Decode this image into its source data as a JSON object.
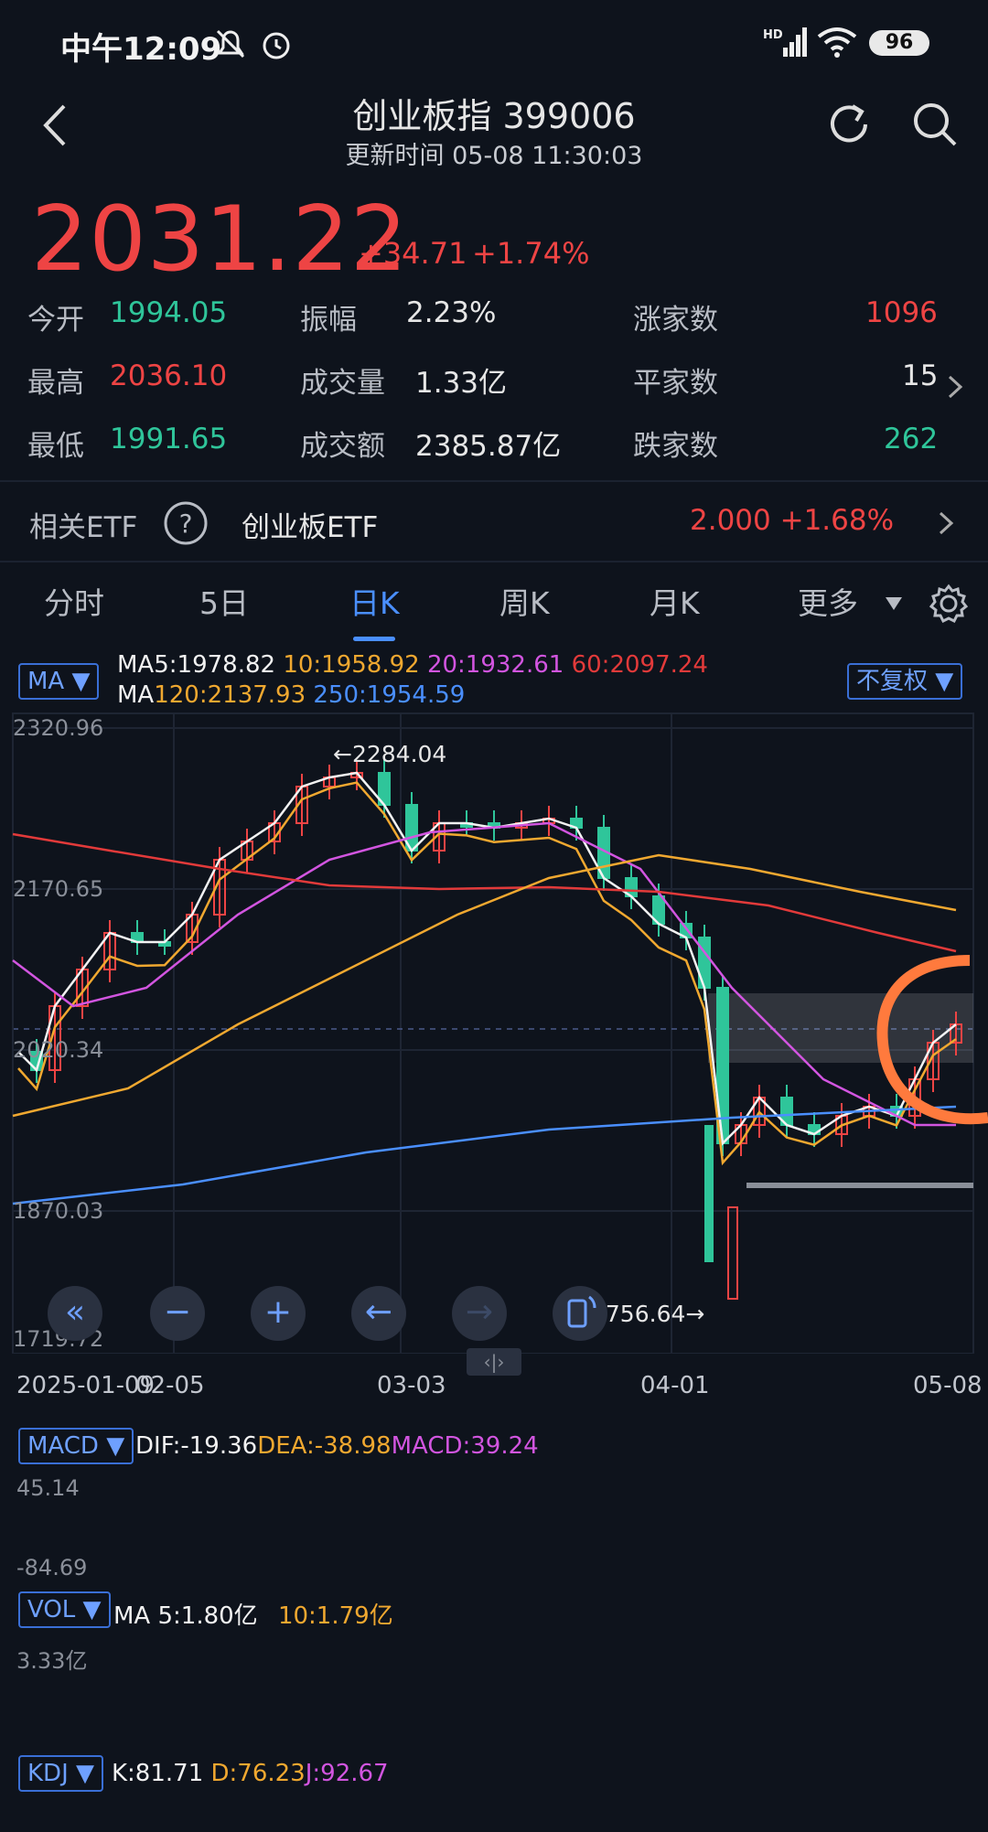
{
  "status_bar": {
    "time": "中午12:09",
    "battery": "96"
  },
  "header": {
    "title": "创业板指 399006",
    "update": "更新时间 05-08 11:30:03"
  },
  "quote": {
    "price": "2031.22",
    "change": "+34.71",
    "change_pct": "+1.74%"
  },
  "stats": [
    {
      "label": "今开",
      "value": "1994.05",
      "color": "green"
    },
    {
      "label": "振幅",
      "value": "2.23%",
      "color": "white"
    },
    {
      "label": "涨家数",
      "value": "1096",
      "color": "red"
    },
    {
      "label": "最高",
      "value": "2036.10",
      "color": "red"
    },
    {
      "label": "成交量",
      "value": "1.33亿",
      "color": "white"
    },
    {
      "label": "平家数",
      "value": "15",
      "color": "white"
    },
    {
      "label": "最低",
      "value": "1991.65",
      "color": "green"
    },
    {
      "label": "成交额",
      "value": "2385.87亿",
      "color": "white"
    },
    {
      "label": "跌家数",
      "value": "262",
      "color": "green"
    }
  ],
  "etf": {
    "label": "相关ETF",
    "name": "创业板ETF",
    "price_change": "2.000 +1.68%"
  },
  "tabs": [
    "分时",
    "5日",
    "日K",
    "周K",
    "月K",
    "更多"
  ],
  "ma_panel": {
    "selector": "MA ▼",
    "rights": "不复权 ▼",
    "line1": [
      {
        "text": "MA5:1978.82",
        "color": "#f2f2f2"
      },
      {
        "text": "10:1958.92",
        "color": "#f0a830"
      },
      {
        "text": "20:1932.61",
        "color": "#d255e0"
      },
      {
        "text": "60:2097.24",
        "color": "#e23a3a"
      }
    ],
    "line2": [
      {
        "text": "MA",
        "color": "#f2f2f2"
      },
      {
        "text": "120:2137.93",
        "color": "#f0a830"
      },
      {
        "text": "250:1954.59",
        "color": "#4a8fff"
      }
    ]
  },
  "price_axis": [
    "2320.96",
    "2170.65",
    "2020.34",
    "1870.03",
    "1719.72"
  ],
  "annotations": {
    "high": "←2284.04",
    "low": "1756.64→"
  },
  "dates": [
    "2025-01-09",
    "02-05",
    "03-03",
    "04-01",
    "05-08"
  ],
  "zoom_buttons": [
    "«",
    "−",
    "+",
    "←",
    "→"
  ],
  "macd": {
    "selector": "MACD ▼",
    "dif": "DIF:-19.36",
    "dea": "DEA:-38.98",
    "macd": "MACD:39.24",
    "top": "45.14",
    "bottom": "-84.69"
  },
  "vol": {
    "selector": "VOL ▼",
    "ma5": "MA 5:1.80亿",
    "ma10": "10:1.79亿",
    "top": "3.33亿"
  },
  "kdj": {
    "selector": "KDJ ▼",
    "k": "K:81.71",
    "d": "D:76.23",
    "j": "J:92.67"
  },
  "colors": {
    "up": "#ee4444",
    "down": "#2fc59a",
    "accent": "#4a8fff",
    "bg": "#0e131c"
  }
}
